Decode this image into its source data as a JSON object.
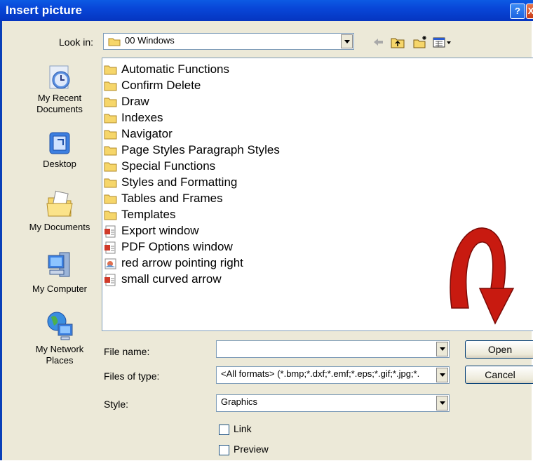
{
  "window": {
    "title": "Insert picture",
    "help_glyph": "?",
    "close_glyph": "X"
  },
  "toolbar": {
    "look_in_label": "Look in:",
    "look_in_value": "00 Windows",
    "icons": [
      "back-arrow-icon",
      "up-folder-icon",
      "new-folder-icon",
      "view-menu-icon"
    ]
  },
  "places": [
    {
      "label": "My Recent Documents",
      "icon": "recent-documents-icon"
    },
    {
      "label": "Desktop",
      "icon": "desktop-icon"
    },
    {
      "label": "My Documents",
      "icon": "my-documents-icon"
    },
    {
      "label": "My Computer",
      "icon": "my-computer-icon"
    },
    {
      "label": "My Network Places",
      "icon": "network-places-icon"
    }
  ],
  "files": [
    {
      "name": "Automatic Functions",
      "kind": "folder"
    },
    {
      "name": "Confirm Delete",
      "kind": "folder"
    },
    {
      "name": "Draw",
      "kind": "folder"
    },
    {
      "name": "Indexes",
      "kind": "folder"
    },
    {
      "name": "Navigator",
      "kind": "folder"
    },
    {
      "name": "Page Styles Paragraph Styles",
      "kind": "folder"
    },
    {
      "name": "Special Functions",
      "kind": "folder"
    },
    {
      "name": "Styles and Formatting",
      "kind": "folder"
    },
    {
      "name": "Tables and Frames",
      "kind": "folder"
    },
    {
      "name": "Templates",
      "kind": "folder"
    },
    {
      "name": "Export window",
      "kind": "image"
    },
    {
      "name": "PDF Options window",
      "kind": "image"
    },
    {
      "name": "red arrow pointing right",
      "kind": "picture"
    },
    {
      "name": "small curved arrow",
      "kind": "image"
    }
  ],
  "form": {
    "file_name_label": "File name:",
    "file_name_value": "",
    "files_of_type_label": "Files of type:",
    "files_of_type_value": "<All formats> (*.bmp;*.dxf;*.emf;*.eps;*.gif;*.jpg;*.",
    "style_label": "Style:",
    "style_value": "Graphics",
    "link_label": "Link",
    "link_checked": false,
    "preview_label": "Preview",
    "preview_checked": false
  },
  "buttons": {
    "open": "Open",
    "cancel": "Cancel"
  },
  "colors": {
    "titlebar": "#0846d8",
    "arrow": "#c81a10",
    "dialog_bg": "#ece9d8"
  }
}
